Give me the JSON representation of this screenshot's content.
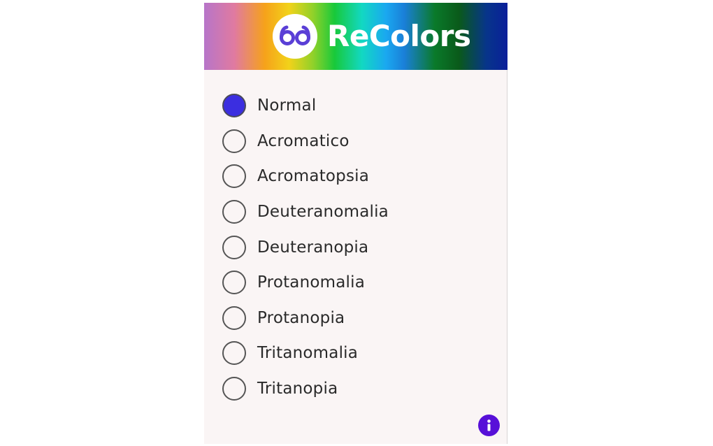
{
  "header": {
    "brand_name": "ReColors",
    "logo_icon": "glasses-logo-icon",
    "logo_color": "#5a3fd6"
  },
  "options": [
    {
      "label": "Normal",
      "checked": true
    },
    {
      "label": "Acromatico",
      "checked": false
    },
    {
      "label": "Acromatopsia",
      "checked": false
    },
    {
      "label": "Deuteranomalia",
      "checked": false
    },
    {
      "label": "Deuteranopia",
      "checked": false
    },
    {
      "label": "Protanomalia",
      "checked": false
    },
    {
      "label": "Protanopia",
      "checked": false
    },
    {
      "label": "Tritanomalia",
      "checked": false
    },
    {
      "label": "Tritanopia",
      "checked": false
    }
  ],
  "footer": {
    "info_icon": "info-icon",
    "info_color": "#5710d8"
  },
  "colors": {
    "accent": "#3b2ee0",
    "background": "#faf5f5"
  }
}
